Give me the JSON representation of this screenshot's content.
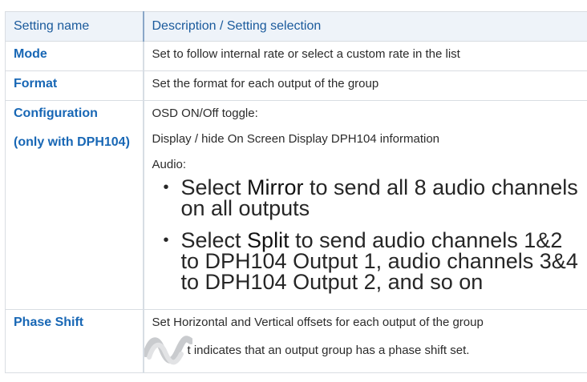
{
  "table": {
    "headers": [
      "Setting name",
      "Description / Setting selection"
    ],
    "rows": {
      "mode": {
        "name": "Mode",
        "description": "Set to follow internal rate or select a custom rate in the list"
      },
      "format": {
        "name": "Format",
        "description": "Set the format for each output of the group"
      },
      "configuration": {
        "name_line1": "Configuration",
        "name_line2": "(only with DPH104)",
        "osd_label": "OSD ON/Off toggle:",
        "osd_desc": "Display / hide On Screen Display DPH104 information",
        "audio_label": "Audio:",
        "bullet1_pre": "Select ",
        "bullet1_bold": "Mirror",
        "bullet1_post": " to send all 8 audio channels on all outputs",
        "bullet2_pre": "Select ",
        "bullet2_bold": "Split",
        "bullet2_post": " to send audio channels 1&2 to DPH104 Output 1, audio channels 3&4 to DPH104 Output 2, and so on"
      },
      "phase_shift": {
        "name": "Phase Shift",
        "description": "Set Horizontal and Vertical offsets for each output of the group",
        "icon_note": "t indicates that an output group has a phase shift set.",
        "icon": "phase-shift-wave-icon"
      }
    }
  },
  "colors": {
    "header_bg": "#eef3f9",
    "header_text": "#1a5a9c",
    "name_text": "#1867b5",
    "border": "#d9dde2"
  }
}
